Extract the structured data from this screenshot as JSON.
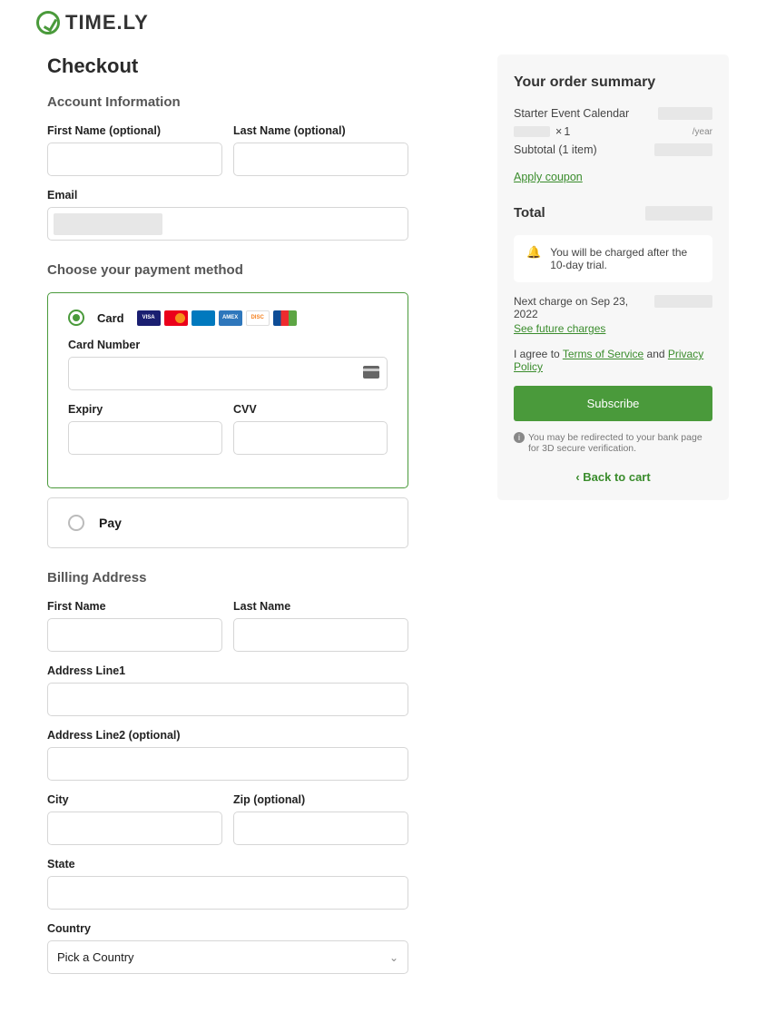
{
  "brand": {
    "name": "TIME.LY"
  },
  "page": {
    "title": "Checkout"
  },
  "account": {
    "heading": "Account Information",
    "first_name_label": "First Name (optional)",
    "last_name_label": "Last Name (optional)",
    "email_label": "Email"
  },
  "payment": {
    "heading": "Choose your payment method",
    "card_label": "Card",
    "card_number_label": "Card Number",
    "expiry_label": "Expiry",
    "cvv_label": "CVV",
    "apple_pay_label": "Pay"
  },
  "billing": {
    "heading": "Billing Address",
    "first_name_label": "First Name",
    "last_name_label": "Last Name",
    "address1_label": "Address Line1",
    "address2_label": "Address Line2 (optional)",
    "city_label": "City",
    "zip_label": "Zip (optional)",
    "state_label": "State",
    "country_label": "Country",
    "country_placeholder": "Pick a Country"
  },
  "summary": {
    "heading": "Your order summary",
    "product_name": "Starter Event Calendar",
    "quantity_prefix": "×",
    "quantity": "1",
    "period_suffix": "/year",
    "subtotal_label": "Subtotal (1 item)",
    "coupon_link": "Apply coupon",
    "total_label": "Total",
    "trial_notice": "You will be charged after the 10-day trial.",
    "next_charge_text": "Next charge on Sep 23, 2022",
    "see_future": "See future charges",
    "agree_prefix": "I agree to ",
    "tos": "Terms of Service",
    "agree_mid": " and ",
    "privacy": "Privacy Policy",
    "subscribe_label": "Subscribe",
    "redirect_note": "You may be redirected to your bank page for 3D secure verification.",
    "back_label": "Back to cart"
  }
}
